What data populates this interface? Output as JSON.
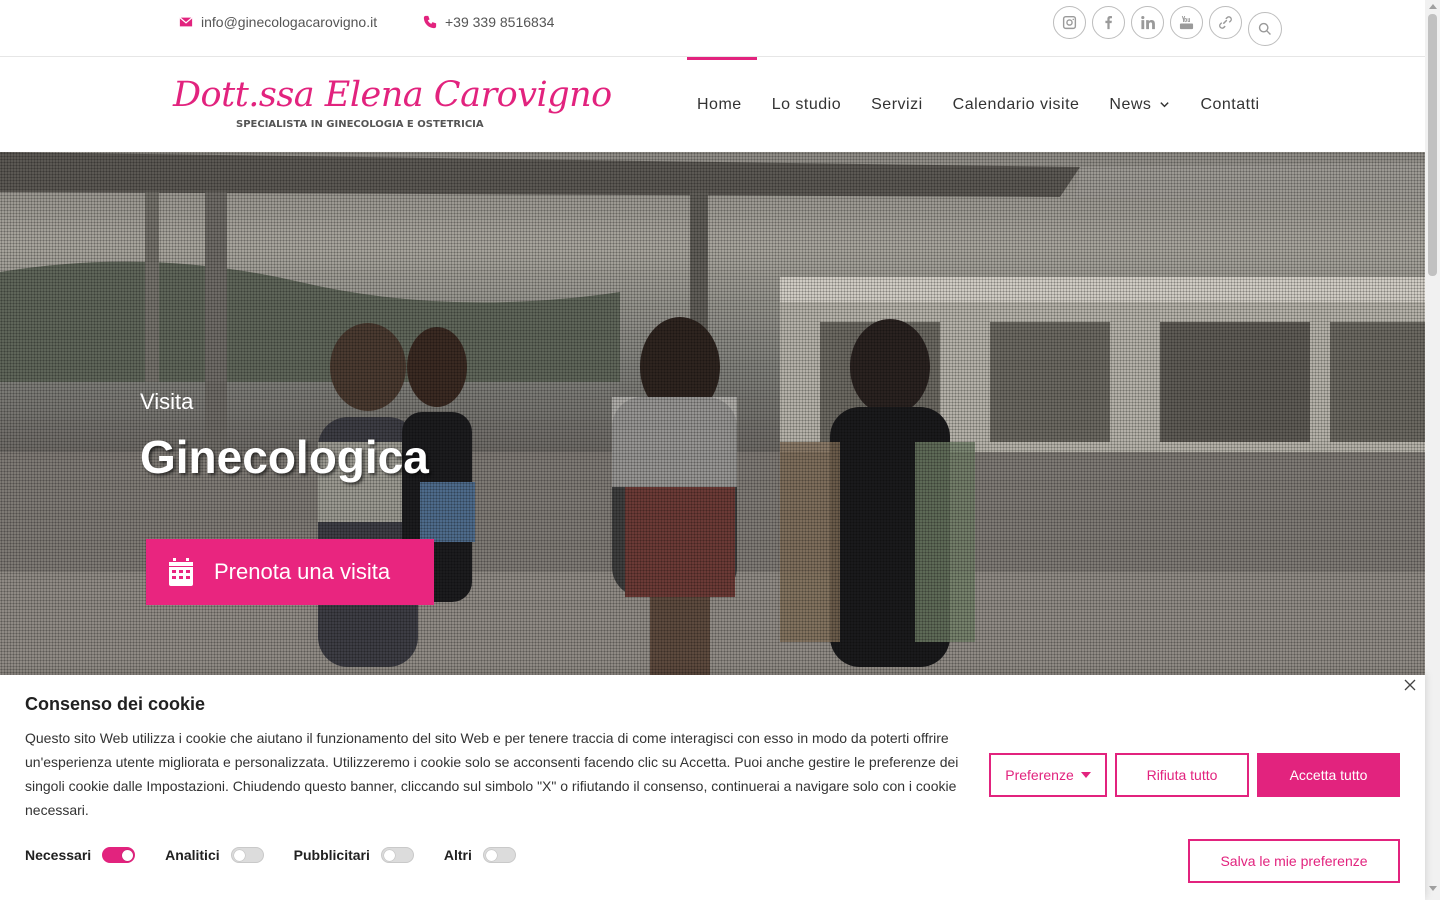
{
  "topbar": {
    "email": "info@ginecologacarovigno.it",
    "phone": "+39 339 8516834",
    "socials": [
      "instagram-icon",
      "facebook-icon",
      "linkedin-icon",
      "youtube-icon",
      "link-icon"
    ],
    "search_icon": "search-icon"
  },
  "logo": {
    "name": "Dott.ssa Elena Carovigno",
    "subtitle": "SPECIALISTA IN GINECOLOGIA E OSTETRICIA"
  },
  "nav": {
    "items": [
      {
        "label": "Home",
        "active": true
      },
      {
        "label": "Lo studio"
      },
      {
        "label": "Servizi"
      },
      {
        "label": "Calendario visite"
      },
      {
        "label": "News",
        "dropdown": true
      },
      {
        "label": "Contatti"
      }
    ]
  },
  "hero": {
    "pre_title": "Visita",
    "title": "Ginecologica",
    "cta_label": "Prenota una visita",
    "cta_icon": "calendar-icon"
  },
  "cookie": {
    "title": "Consenso dei cookie",
    "text": "Questo sito Web utilizza i cookie che aiutano il funzionamento del sito Web e per tenere traccia di come interagisci con esso in modo da poterti offrire un'esperienza utente migliorata e personalizzata. Utilizzeremo i cookie solo se acconsenti facendo clic su Accetta. Puoi anche gestire le preferenze dei singoli cookie dalle Impostazioni. Chiudendo questo banner, cliccando sul simbolo \"X\" o rifiutando il consenso, continuerai a navigare solo con i cookie necessari.",
    "buttons": {
      "preferences": "Preferenze",
      "reject": "Rifiuta tutto",
      "accept": "Accetta tutto",
      "save": "Salva le mie preferenze"
    },
    "toggles": [
      {
        "label": "Necessari",
        "on": true
      },
      {
        "label": "Analitici",
        "on": false
      },
      {
        "label": "Pubblicitari",
        "on": false
      },
      {
        "label": "Altri",
        "on": false
      }
    ]
  },
  "colors": {
    "accent": "#e2237e",
    "cta": "#e9257f"
  }
}
